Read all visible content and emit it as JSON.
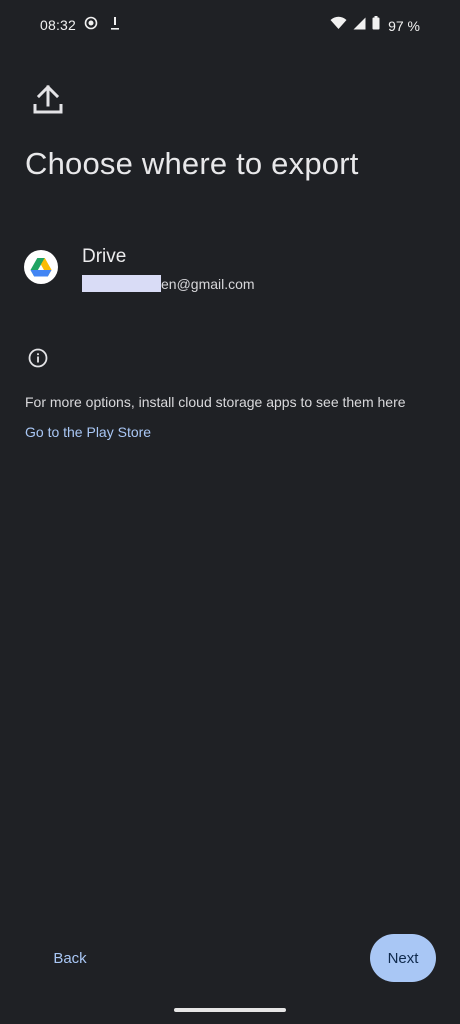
{
  "status_bar": {
    "time": "08:32",
    "battery_text": "97 %",
    "icons": [
      "screen-record-icon",
      "download-icon",
      "wifi-icon",
      "cell-signal-icon",
      "battery-icon"
    ]
  },
  "header": {
    "icon": "upload-icon",
    "title": "Choose where to export"
  },
  "account": {
    "provider_icon": "google-drive-icon",
    "provider_name": "Drive",
    "email_visible": "en@gmail.com"
  },
  "info": {
    "icon": "info-icon",
    "text": "For more options, install cloud storage apps to see them here",
    "link_label": "Go to the Play Store"
  },
  "footer": {
    "back_label": "Back",
    "next_label": "Next"
  },
  "colors": {
    "background": "#1f2125",
    "accent": "#a9c7f5",
    "text_primary": "#e8e8ea"
  }
}
